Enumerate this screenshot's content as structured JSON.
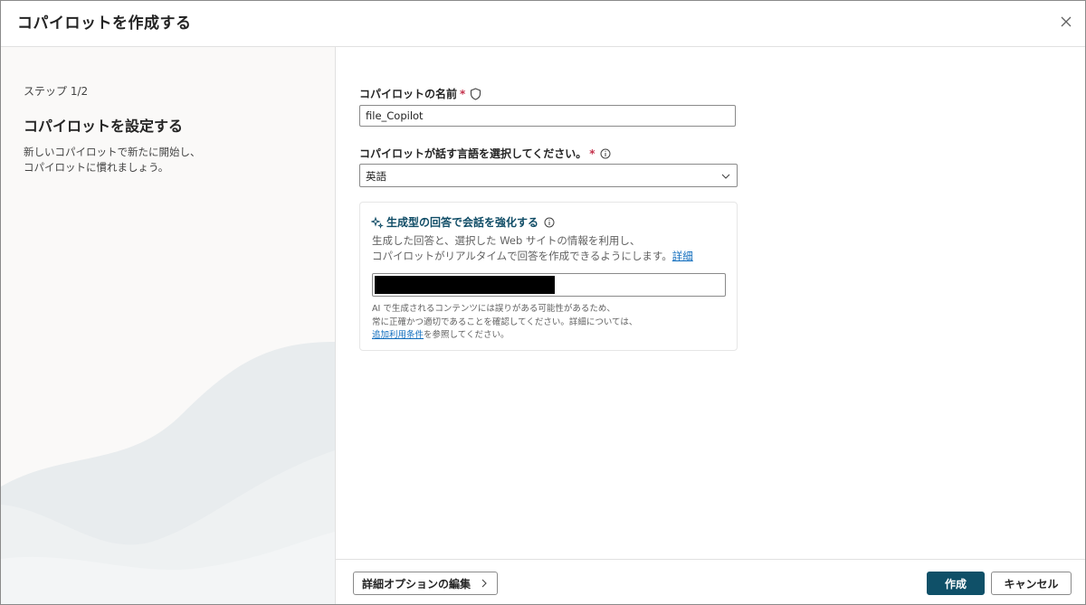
{
  "dialog": {
    "title": "コパイロットを作成する"
  },
  "left_panel": {
    "step": "ステップ 1/2",
    "heading": "コパイロットを設定する",
    "description_lines": [
      "新しいコパイロットで新たに開始し、",
      "コパイロットに慣れましょう。"
    ]
  },
  "form": {
    "name_label": "コパイロットの名前",
    "name_value": "file_Copilot",
    "required_mark": "*",
    "language_label": "コパイロットが話す言語を選択してください。",
    "language_value": "英語"
  },
  "card": {
    "title": "生成型の回答で会話を強化する",
    "desc_line1": "生成した回答と、選択した Web サイトの情報を利用し、",
    "desc_line2": "コパイロットがリアルタイムで回答を作成できるようにします。",
    "learn_more": "詳細",
    "note_line1": "AI で生成されるコンテンツには誤りがある可能性があるため、",
    "note_line2": "常に正確かつ適切であることを確認してください。詳細については、",
    "terms_link": "追加利用条件",
    "note_line3_suffix": "を参照してください。"
  },
  "footer": {
    "advanced_label": "詳細オプションの編集",
    "create_label": "作成",
    "cancel_label": "キャンセル"
  },
  "icons": {
    "close": "close-icon",
    "shield": "shield-icon",
    "info": "info-icon",
    "chevron_down": "chevron-down-icon",
    "sparkle": "sparkle-icon",
    "chevron_right": "chevron-right-icon"
  },
  "colors": {
    "primary": "#0f5068",
    "link": "#0f6cbd",
    "required": "#c4314b",
    "card_title": "#0f4c66"
  }
}
